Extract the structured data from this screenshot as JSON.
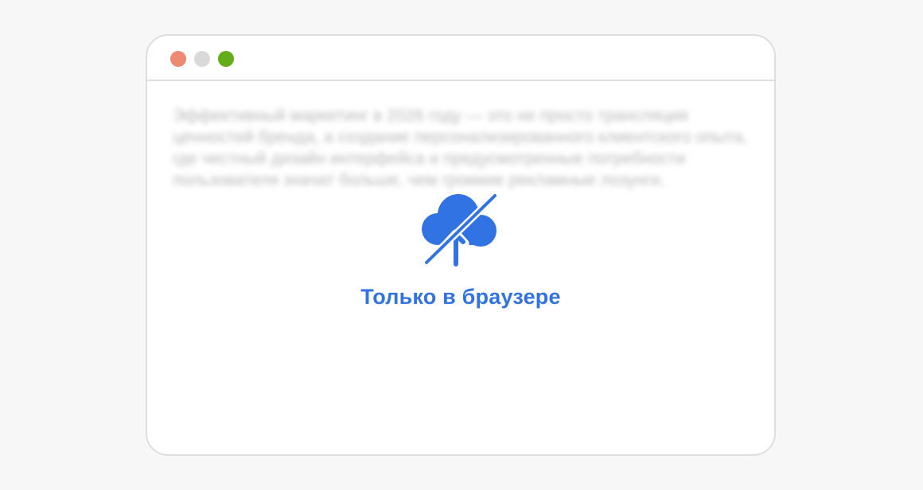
{
  "colors": {
    "page_background": "#f7f7f7",
    "window_border": "#dedede",
    "dot_close": "#ee8a74",
    "dot_minimize": "#d9d9d9",
    "dot_maximize": "#63ad1a",
    "accent": "#3173e3",
    "blurred_text": "#b9b9b9"
  },
  "window": {
    "controls": [
      "close",
      "minimize",
      "maximize"
    ]
  },
  "content": {
    "blurred_text": "Эффективный маркетинг в 2026 году — это не просто трансляция ценностей бренда, а создание персонализированного клиентского опыта, где честный дизайн интерфейса и предусмотренные потребности пользователя значат больше, чем громкие рекламные лозунги."
  },
  "notice": {
    "icon": "cloud-upload-off-icon",
    "label": "Только в браузере"
  }
}
